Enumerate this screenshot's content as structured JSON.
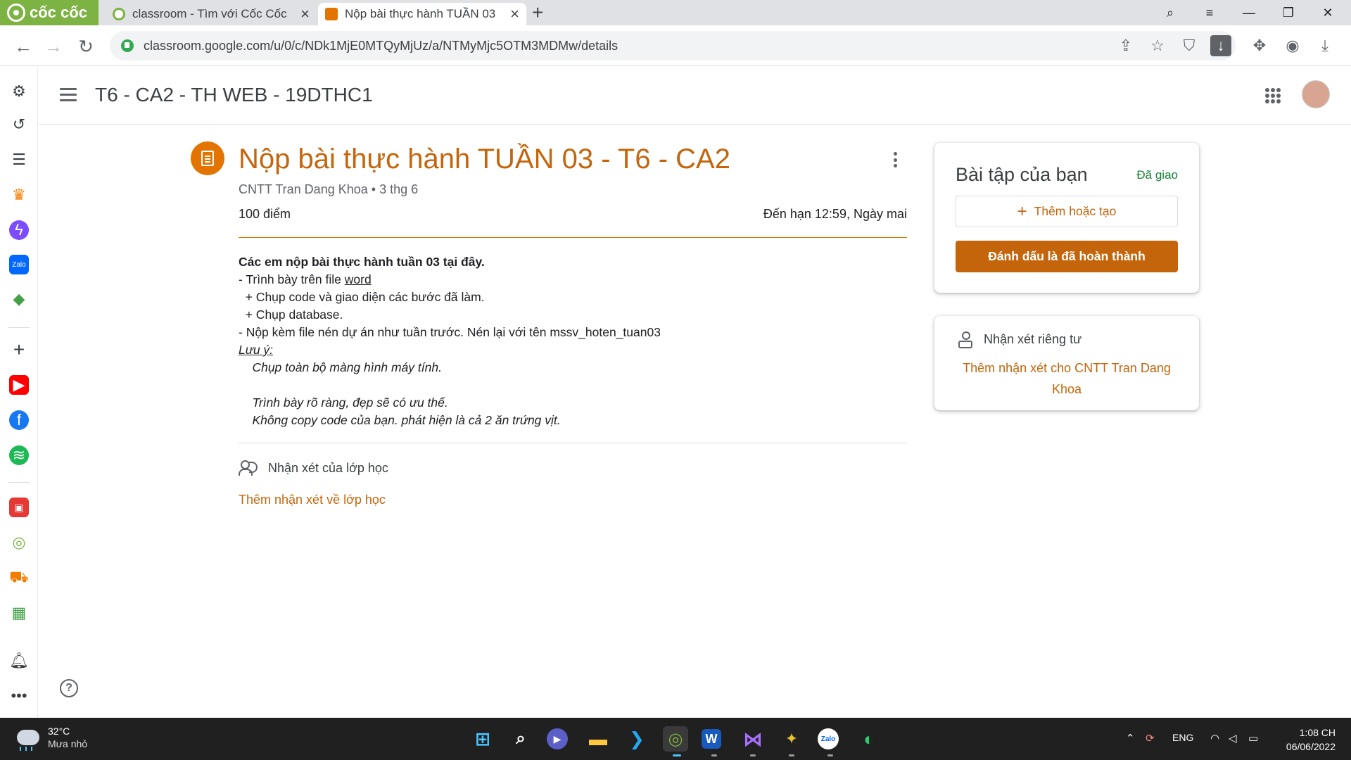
{
  "browser": {
    "brand": "cốc cốc",
    "tabs": [
      {
        "title": "classroom - Tìm với Cốc Cốc",
        "favicon": "coccoc-icon"
      },
      {
        "title": "Nộp bài thực hành TUẦN 03",
        "favicon": "classroom-icon"
      }
    ],
    "url": "classroom.google.com/u/0/c/NDk1MjE0MTQyMjUz/a/NTMyMjc5OTM3MDMw/details"
  },
  "header": {
    "class_name": "T6 - CA2 - TH WEB - 19DTHC1"
  },
  "assignment": {
    "title": "Nộp bài thực hành TUẦN 03 - T6 - CA2",
    "author": "CNTT Tran Dang Khoa",
    "posted": "3 thg 6",
    "points": "100 điểm",
    "due": "Đến hạn 12:59, Ngày mai",
    "description": {
      "heading": "Các em nộp bài thực hành tuần 03 tại đây.",
      "line1_prefix": "- Trình bày trên file ",
      "line1_link": "word",
      "line2": "  + Chụp code và giao diện các bước đã làm.",
      "line3": "  + Chụp database.",
      "line4": "- Nộp kèm file nén dự án như tuần trước. Nén lại với tên mssv_hoten_tuan03",
      "note_label": "Lưu ý:",
      "note1": "    Chụp toàn bộ màng hình máy tính.",
      "note2": "    Trình bày rõ ràng, đẹp sẽ có ưu thế.",
      "note3": "    Không copy code của bạn. phát hiện là cả 2 ăn trứng vịt."
    },
    "class_comments_label": "Nhận xét của lớp học",
    "add_class_comment": "Thêm nhận xét về lớp học"
  },
  "your_work": {
    "title": "Bài tập của bạn",
    "status": "Đã giao",
    "add_button": "Thêm hoặc tạo",
    "mark_done_button": "Đánh dấu là đã hoàn thành"
  },
  "private_comments": {
    "title": "Nhận xét riêng tư",
    "add_link": "Thêm nhận xét cho CNTT Tran Dang Khoa"
  },
  "taskbar": {
    "temperature": "32°C",
    "weather": "Mưa nhỏ",
    "language": "ENG",
    "time": "1:08 CH",
    "date": "06/06/2022",
    "apps": [
      "start-icon",
      "search-icon",
      "chat-icon",
      "file-explorer-icon",
      "vscode-icon",
      "coccoc-icon",
      "word-icon",
      "visual-studio-icon",
      "app-icon",
      "zalo-icon",
      "edge-icon"
    ]
  },
  "colors": {
    "accent": "#c5650b",
    "icon_bg": "#e37400",
    "status_green": "#188038",
    "brand_green": "#7cb342"
  }
}
